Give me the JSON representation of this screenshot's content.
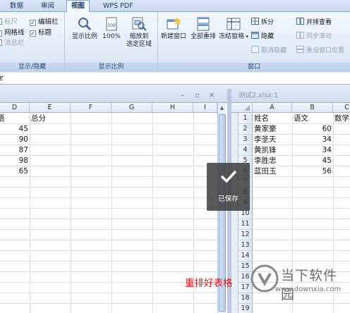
{
  "ribbon": {
    "tabs": [
      "数据",
      "审阅",
      "视图",
      "WPS PDF"
    ],
    "active_tab": "视图",
    "show_hide": {
      "ruler": "标尺",
      "gridlines": "网格线",
      "message_bar": "消息栏",
      "formula_bar": "编辑栏",
      "headings": "标题",
      "group_label": "显示/隐藏"
    },
    "zoom": {
      "zoom_label": "显示比例",
      "zoom100_label": "100%",
      "zoom_selection_line1": "缩放到",
      "zoom_selection_line2": "选定区域",
      "group_label": "显示比例"
    },
    "window": {
      "new_window": "新建窗口",
      "arrange_all": "全部重排",
      "freeze_panes": "冻结窗格",
      "split": "拆分",
      "hide": "隐藏",
      "unhide": "取消隐藏",
      "side_by_side": "并排查看",
      "sync_scroll": "同步滚动",
      "reset_position": "重设窗口位置",
      "group_label": "窗口"
    }
  },
  "formula_bar": {
    "text": "字"
  },
  "left_pane": {
    "columns": [
      "D",
      "E",
      "F",
      "G",
      "H",
      "I"
    ],
    "rows": [
      [
        "语",
        "总分"
      ],
      [
        "45",
        ""
      ],
      [
        "90",
        ""
      ],
      [
        "87",
        ""
      ],
      [
        "98",
        ""
      ],
      [
        "65",
        ""
      ]
    ]
  },
  "right_pane": {
    "title": "测试2.xlsx:1",
    "columns": [
      "A",
      "B",
      "C"
    ],
    "row_numbers": [
      "1",
      "2",
      "3",
      "4",
      "5",
      "6",
      "7",
      "8",
      "9",
      "10",
      "11",
      "12",
      "13",
      "14",
      "15",
      "16",
      "17",
      "18",
      "19"
    ],
    "rows": [
      [
        "姓名",
        "语文",
        "数学"
      ],
      [
        "黄家豪",
        "60",
        ""
      ],
      [
        "李圣天",
        "34",
        ""
      ],
      [
        "黄凯锋",
        "34",
        ""
      ],
      [
        "李胜忠",
        "45",
        ""
      ],
      [
        "蓝田玉",
        "56",
        ""
      ]
    ]
  },
  "toast": {
    "label": "已保存"
  },
  "caption": "重排好表格",
  "watermark": {
    "title": "当下软件园",
    "url": "www.downxia.com"
  }
}
